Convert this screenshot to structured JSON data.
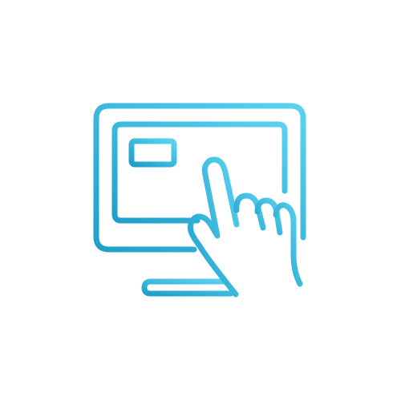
{
  "icon": {
    "name": "touchscreen-monitor-icon",
    "parts": [
      "monitor-icon",
      "screen-icon",
      "content-card-icon",
      "hand-pointer-icon"
    ],
    "colors": {
      "gradient_start": "#5ad2f2",
      "gradient_end": "#1f9fc9",
      "background": "#ffffff"
    }
  }
}
